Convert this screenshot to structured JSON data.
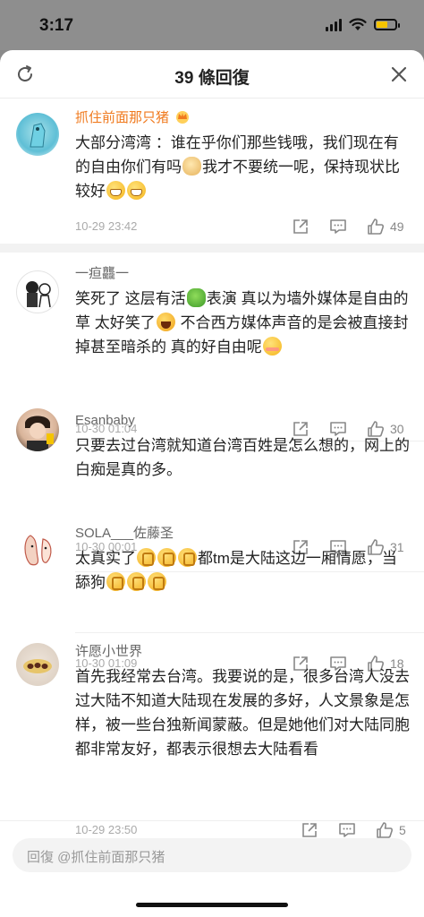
{
  "status": {
    "time": "3:17"
  },
  "header": {
    "title": "39 條回復",
    "refresh_icon": "refresh-icon",
    "close_icon": "close-icon"
  },
  "comments": [
    {
      "name": "抓住前面那只猪",
      "name_color": "#f07a1e",
      "text_parts": [
        "大部分湾湾 ：谁在乎你们那些钱哦，我们现在有的自由你们有吗",
        "我才不要统一呢，保持现状比较好",
        "",
        ""
      ],
      "time": "10-29 23:42",
      "likes": "49"
    },
    {
      "name": "一疸龘一",
      "text_parts": [
        "笑死了 这层有活",
        "表演 真以为墙外媒体是自由的 草 太好笑了",
        " 不合西方媒体声音的是会被直接封掉甚至暗杀的 真的好自由呢",
        ""
      ],
      "time": "10-30 01:04",
      "likes": "30"
    },
    {
      "name": "Esanbaby",
      "text": "只要去过台湾就知道台湾百姓是怎么想的，网上的白痴是真的多。",
      "time": "10-30 00:01",
      "likes": "31"
    },
    {
      "name": "SOLA___佐藤圣",
      "text_parts": [
        "太真实了",
        "都tm是大陆这边一厢情愿，当舔狗"
      ],
      "time": "10-30 01:09",
      "likes": "18"
    },
    {
      "name": "许愿小世界",
      "text": "首先我经常去台湾。我要说的是，很多台湾人没去过大陆不知道大陆现在发展的多好，人文景象是怎样，被一些台独新闻蒙蔽。但是她他们对大陆同胞都非常友好，都表示很想去大陆看看",
      "time": "10-29 23:50",
      "likes": "5"
    }
  ],
  "reply": {
    "placeholder": "回復 @抓住前面那只猪"
  },
  "colors": {
    "accent": "#f07a1e",
    "text": "#222222",
    "meta": "#aaaaaa"
  }
}
